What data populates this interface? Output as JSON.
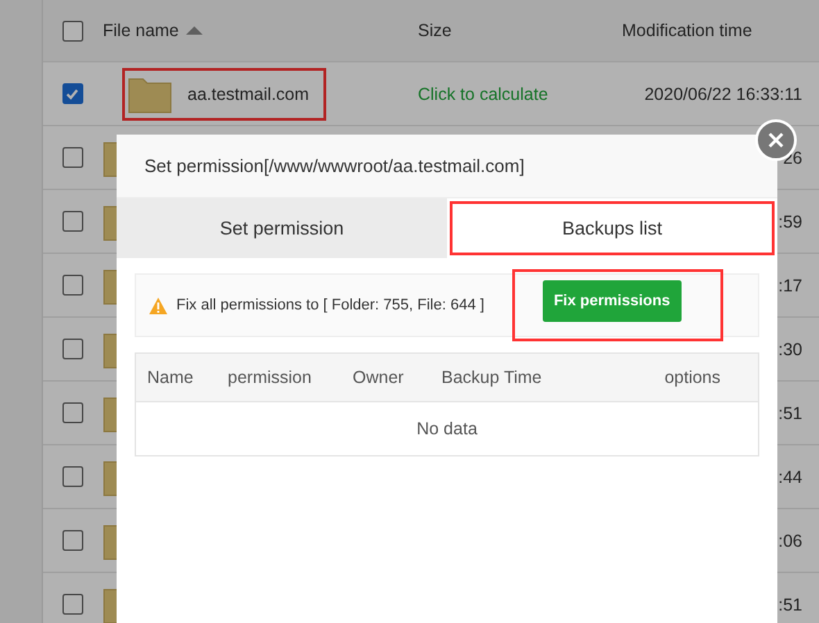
{
  "file_table": {
    "all_selected": false,
    "columns": [
      {
        "label": "File name",
        "sorted": true
      },
      {
        "label": "Size"
      },
      {
        "label": "Modification time"
      }
    ],
    "rows": [
      {
        "checked": true,
        "name": "aa.testmail.com",
        "highlighted": true,
        "size": "Click to calculate",
        "time": "2020/06/22 16:33:11"
      },
      {
        "checked": false,
        "time": "26"
      },
      {
        "checked": false,
        "time": ":59"
      },
      {
        "checked": false,
        "time": ":17"
      },
      {
        "checked": false,
        "time": ":30"
      },
      {
        "checked": false,
        "time": ":51"
      },
      {
        "checked": false,
        "time": ":44"
      },
      {
        "checked": false,
        "time": ":06"
      },
      {
        "checked": false,
        "time": ":51"
      }
    ]
  },
  "dialog": {
    "title": "Set permission[/www/wwwroot/aa.testmail.com]",
    "tabs": [
      {
        "label": "Set permission",
        "selected": false,
        "highlighted": false
      },
      {
        "label": "Backups list",
        "selected": true,
        "highlighted": true
      }
    ],
    "notice": {
      "text": "Fix all permissions to [ Folder: 755, File: 644 ]",
      "button": {
        "label": "Fix permissions",
        "highlighted": true
      }
    },
    "backup_table": {
      "columns": [
        "Name",
        "permission",
        "Owner",
        "Backup Time",
        "options"
      ],
      "empty_text": "No data"
    }
  }
}
